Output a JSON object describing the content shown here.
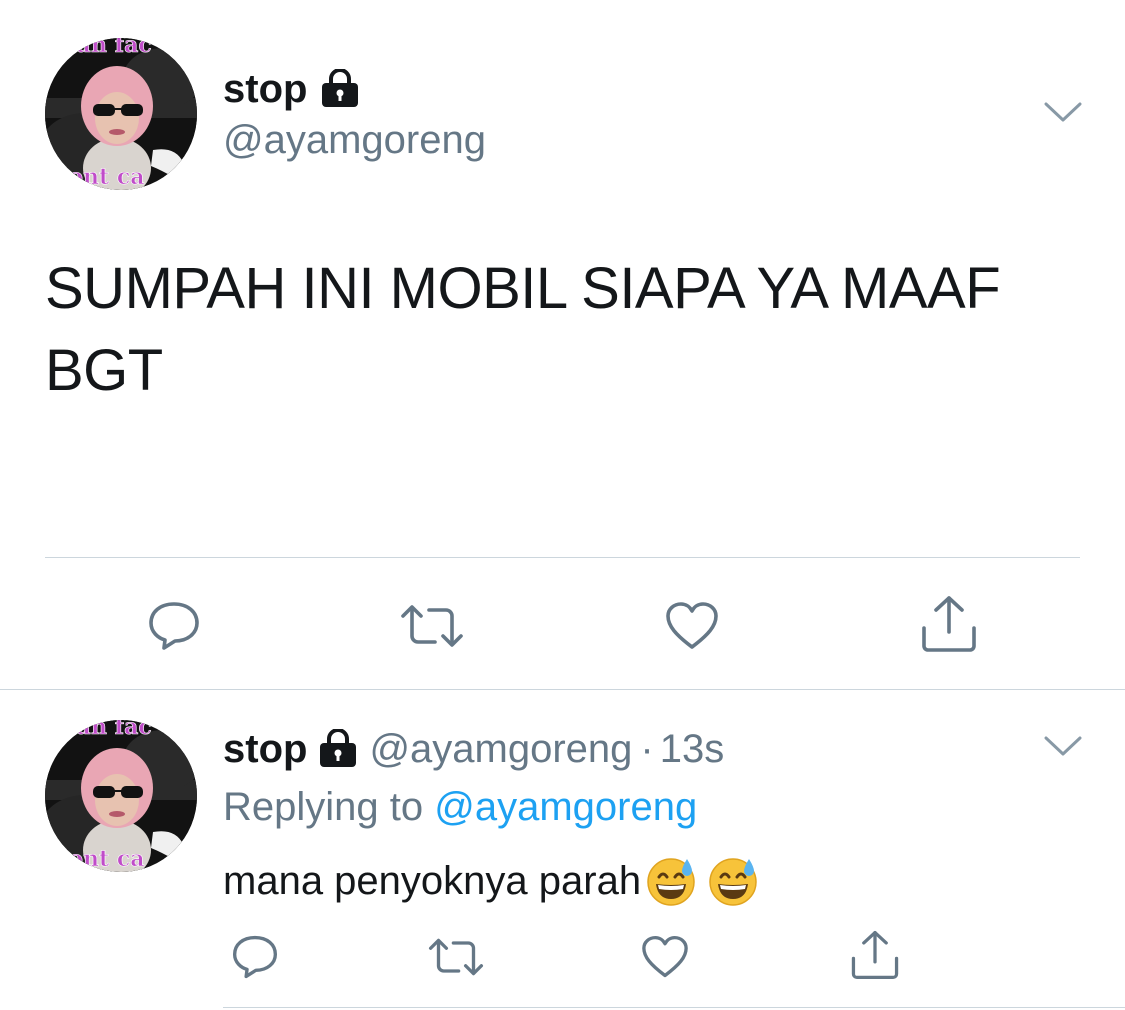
{
  "main_tweet": {
    "display_name": "stop",
    "handle": "@ayamgoreng",
    "text": "SUMPAH INI MOBIL SIAPA YA MAAF BGT",
    "avatar_caption_top": "un fac",
    "avatar_caption_bottom": "dont ca",
    "actions": [
      "reply-icon",
      "retweet-icon",
      "like-icon",
      "share-icon"
    ]
  },
  "reply_tweet": {
    "display_name": "stop",
    "handle": "@ayamgoreng",
    "separator": "·",
    "timestamp": "13s",
    "replying_label": "Replying to",
    "replying_to": "@ayamgoreng",
    "text": "mana penyoknya parah",
    "emojis": [
      "grinning-sweat-emoji",
      "grinning-sweat-emoji"
    ],
    "avatar_caption_top": "un fac",
    "avatar_caption_bottom": "dont ca",
    "actions": [
      "reply-icon",
      "retweet-icon",
      "like-icon",
      "share-icon"
    ]
  },
  "colors": {
    "primary_text": "#14171a",
    "secondary_text": "#657786",
    "link": "#1da1f2",
    "divider": "#ccd6dd",
    "icon": "#657786"
  }
}
